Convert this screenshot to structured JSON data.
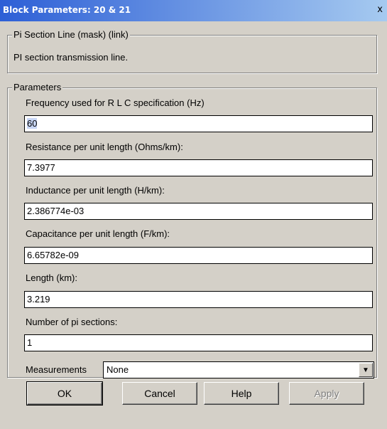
{
  "window": {
    "title": "Block Parameters: 20 & 21",
    "close_glyph": "x"
  },
  "mask": {
    "legend": "Pi Section Line (mask) (link)",
    "description": "PI section transmission line."
  },
  "parameters": {
    "legend": "Parameters",
    "frequency": {
      "label": "Frequency used for R L C specification (Hz)",
      "value": "60"
    },
    "resistance": {
      "label": "Resistance per unit length (Ohms/km):",
      "value": "7.3977"
    },
    "inductance": {
      "label": "Inductance per unit length (H/km):",
      "value": "2.386774e-03"
    },
    "capacitance": {
      "label": "Capacitance per unit length (F/km):",
      "value": "6.65782e-09"
    },
    "length": {
      "label": "Length (km):",
      "value": "3.219"
    },
    "sections": {
      "label": "Number of pi sections:",
      "value": "1"
    },
    "measurements": {
      "label": "Measurements",
      "selected": "None",
      "icon": "chevron-down-icon"
    }
  },
  "buttons": {
    "ok": "OK",
    "cancel": "Cancel",
    "help": "Help",
    "apply": "Apply"
  }
}
